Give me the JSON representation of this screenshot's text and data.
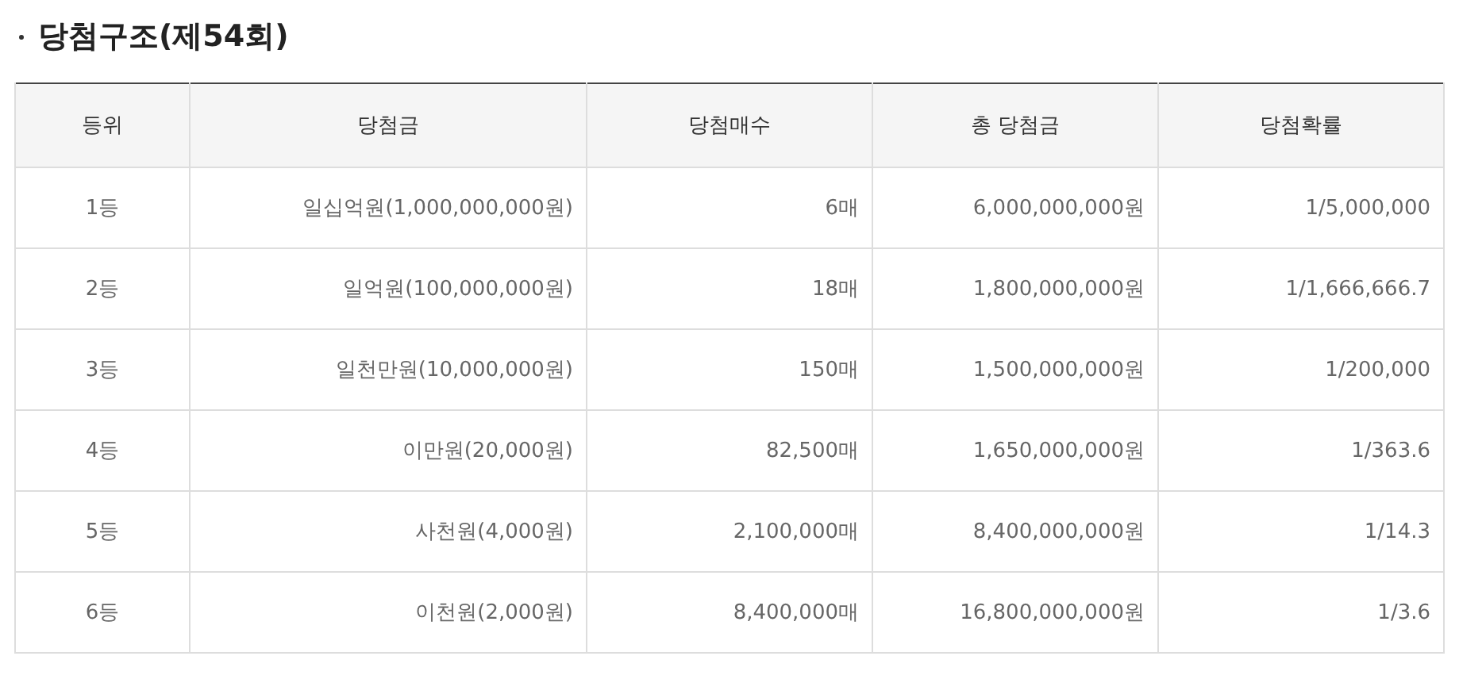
{
  "title": "당첨구조(제54회)",
  "table": {
    "columns": [
      "등위",
      "당첨금",
      "당첨매수",
      "총 당첨금",
      "당첨확률"
    ],
    "rows": [
      [
        "1등",
        "일십억원(1,000,000,000원)",
        "6매",
        "6,000,000,000원",
        "1/5,000,000"
      ],
      [
        "2등",
        "일억원(100,000,000원)",
        "18매",
        "1,800,000,000원",
        "1/1,666,666.7"
      ],
      [
        "3등",
        "일천만원(10,000,000원)",
        "150매",
        "1,500,000,000원",
        "1/200,000"
      ],
      [
        "4등",
        "이만원(20,000원)",
        "82,500매",
        "1,650,000,000원",
        "1/363.6"
      ],
      [
        "5등",
        "사천원(4,000원)",
        "2,100,000매",
        "8,400,000,000원",
        "1/14.3"
      ],
      [
        "6등",
        "이천원(2,000원)",
        "8,400,000매",
        "16,800,000,000원",
        "1/3.6"
      ]
    ]
  }
}
